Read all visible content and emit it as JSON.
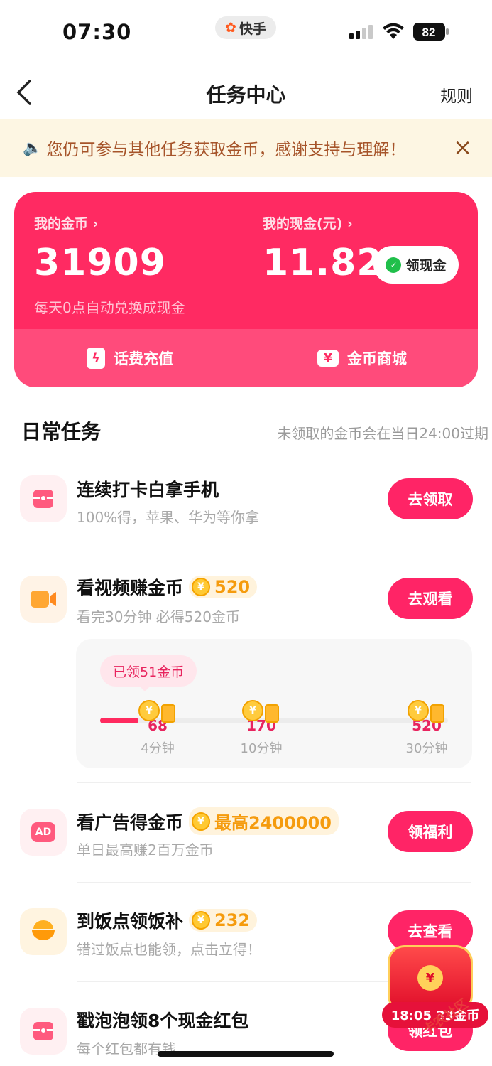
{
  "status": {
    "time": "07:30",
    "app": "快手",
    "battery": "82"
  },
  "nav": {
    "title": "任务中心",
    "rules": "规则",
    "back": "‹"
  },
  "notice": {
    "text": "您仍可参与其他任务获取金币，感谢支持与理解！",
    "close": "×"
  },
  "wallet": {
    "coins_label": "我的金币 ›",
    "coins": "31909",
    "coins_note": "每天0点自动兑换成现金",
    "cash_label": "我的现金(元) ›",
    "cash": "11.82",
    "withdraw": "领现金",
    "actions": [
      {
        "label": "话费充值",
        "icon": "lightning-icon"
      },
      {
        "label": "金币商城",
        "icon": "ticket-icon"
      }
    ]
  },
  "daily": {
    "title": "日常任务",
    "note": "未领取的金币会在当日24:00过期"
  },
  "tasks": [
    {
      "title": "连续打卡白拿手机",
      "desc": "100%得，苹果、华为等你拿",
      "button": "去领取",
      "icon": "gift-box-icon"
    },
    {
      "title": "看视频赚金币",
      "reward": "520",
      "desc": "看完30分钟 必得520金币",
      "button": "去观看",
      "icon": "video-camera-icon"
    },
    {
      "title": "看广告得金币",
      "reward": "最高2400000",
      "desc": "单日最高赚2百万金币",
      "button": "领福利",
      "icon": "ad-icon",
      "icon_text": "AD"
    },
    {
      "title": "到饭点领饭补",
      "reward": "232",
      "desc": "错过饭点也能领，点击立得！",
      "button": "去查看",
      "icon": "rice-bowl-icon"
    },
    {
      "title": "戳泡泡领8个现金红包",
      "desc": "每个红包都有钱",
      "button": "领红包",
      "icon": "gift-box-icon"
    }
  ],
  "video_progress": {
    "claimed": "已领51金币",
    "progress_fraction": 0.11,
    "milestones": [
      {
        "coins": "68",
        "time": "4分钟"
      },
      {
        "coins": "170",
        "time": "10分钟"
      },
      {
        "coins": "520",
        "time": "30分钟"
      }
    ]
  },
  "float_widget": {
    "timer": "18:05 33金币"
  },
  "watermark": "卡农社区",
  "colors": {
    "brand": "#ff2466",
    "card": "#ff2a62",
    "coin": "#f59b0d",
    "notice_bg": "#fdf6e3"
  }
}
